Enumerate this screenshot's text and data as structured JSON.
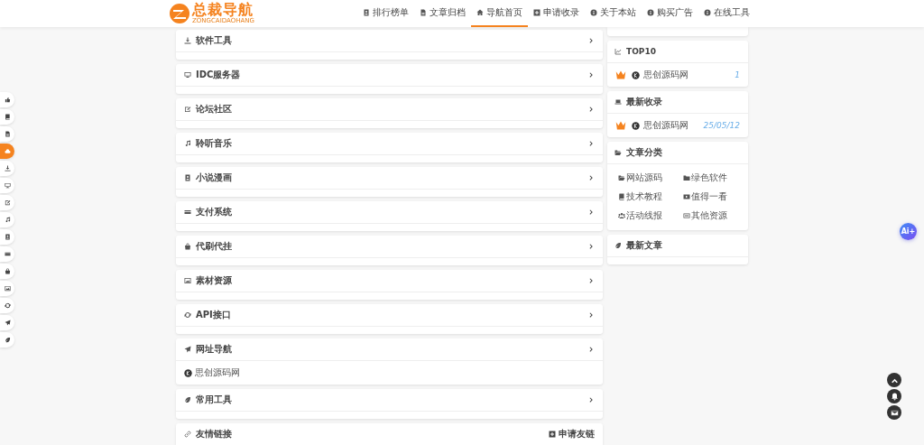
{
  "header": {
    "logo": {
      "title": "总裁导航",
      "subtitle": "ZONGCAIDAOHANG"
    },
    "nav": [
      {
        "label": "排行榜单",
        "selected": false
      },
      {
        "label": "文章归档",
        "selected": false
      },
      {
        "label": "导航首页",
        "selected": true
      },
      {
        "label": "申请收录",
        "selected": false
      },
      {
        "label": "关于本站",
        "selected": false
      },
      {
        "label": "购买广告",
        "selected": false
      },
      {
        "label": "在线工具",
        "selected": false
      }
    ]
  },
  "side_rail": [
    {
      "selected": false
    },
    {
      "selected": false
    },
    {
      "selected": false
    },
    {
      "selected": true
    },
    {
      "selected": false
    },
    {
      "selected": false
    },
    {
      "selected": false
    },
    {
      "selected": false
    },
    {
      "selected": false
    },
    {
      "selected": false
    },
    {
      "selected": false
    },
    {
      "selected": false
    },
    {
      "selected": false
    },
    {
      "selected": false
    },
    {
      "selected": false
    }
  ],
  "categories": [
    {
      "title": "软件工具"
    },
    {
      "title": "IDC服务器"
    },
    {
      "title": "论坛社区"
    },
    {
      "title": "聆听音乐"
    },
    {
      "title": "小说漫画"
    },
    {
      "title": "支付系统"
    },
    {
      "title": "代刷代挂"
    },
    {
      "title": "素材资源"
    },
    {
      "title": "API接口"
    },
    {
      "title": "网址导航",
      "links": [
        {
          "name": "思创源码网"
        }
      ]
    },
    {
      "title": "常用工具"
    }
  ],
  "friend_links": {
    "title": "友情链接",
    "action": "申请友链"
  },
  "top10": {
    "title": "TOP10",
    "items": [
      {
        "name": "思创源码网",
        "value": "1"
      }
    ]
  },
  "latest": {
    "title": "最新收录",
    "items": [
      {
        "name": "思创源码网",
        "value": "25/05/12"
      }
    ]
  },
  "article_categories": {
    "title": "文章分类",
    "items": [
      "网站源码",
      "绿色软件",
      "技术教程",
      "值得一看",
      "活动线报",
      "其他资源"
    ]
  },
  "latest_articles": {
    "title": "最新文章"
  },
  "ai_button": "Ai+"
}
